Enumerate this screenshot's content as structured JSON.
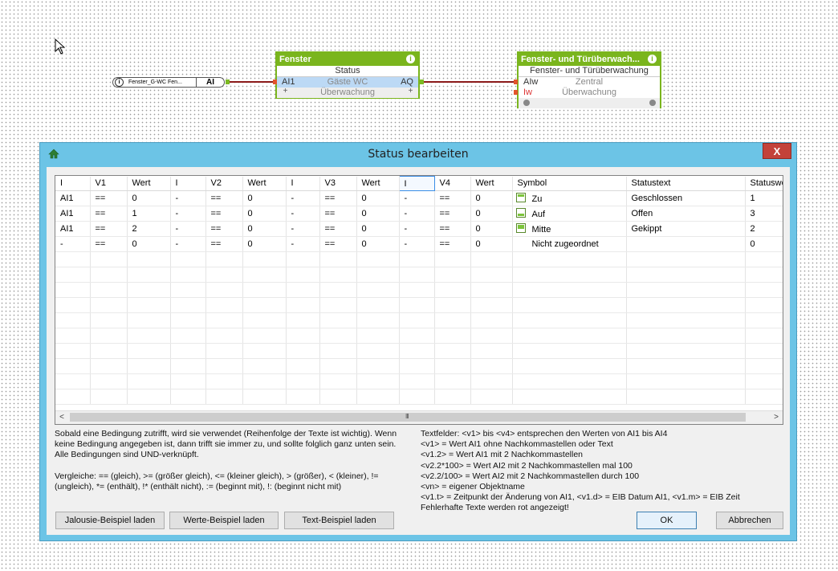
{
  "canvas": {
    "input_node": {
      "info": "i",
      "name": "Fenster_G-WC  Fen...",
      "port": "AI"
    },
    "block1": {
      "title": "Fenster",
      "info": "i",
      "subtitle": "Status",
      "row_left": "AI1",
      "row_center": "Gäste WC",
      "row_right": "AQ",
      "footer_left": "+",
      "footer_center": "Überwachung",
      "footer_right": "+"
    },
    "block2": {
      "title": "Fenster- und Türüberwach...",
      "info": "i",
      "subtitle": "Fenster- und Türüberwachung",
      "row1_left": "AIw",
      "row1_center": "Zentral",
      "row2_left": "Iw",
      "row2_center": "Überwachung"
    }
  },
  "dialog": {
    "title": "Status bearbeiten",
    "close": "X",
    "columns": [
      "I",
      "V1",
      "Wert",
      "I",
      "V2",
      "Wert",
      "I",
      "V3",
      "Wert",
      "I",
      "V4",
      "Wert",
      "Symbol",
      "Statustext",
      "Statuswe"
    ],
    "rows": [
      {
        "c": [
          "AI1",
          "==",
          "0",
          "-",
          "==",
          "0",
          "-",
          "==",
          "0",
          "-",
          "==",
          "0"
        ],
        "sym": "down",
        "symbol": "Zu",
        "text": "Geschlossen",
        "value": "1"
      },
      {
        "c": [
          "AI1",
          "==",
          "1",
          "-",
          "==",
          "0",
          "-",
          "==",
          "0",
          "-",
          "==",
          "0"
        ],
        "sym": "up",
        "symbol": "Auf",
        "text": "Offen",
        "value": "3"
      },
      {
        "c": [
          "AI1",
          "==",
          "2",
          "-",
          "==",
          "0",
          "-",
          "==",
          "0",
          "-",
          "==",
          "0"
        ],
        "sym": "mid",
        "symbol": "Mitte",
        "text": "Gekippt",
        "value": "2"
      },
      {
        "c": [
          "-",
          "==",
          "0",
          "-",
          "==",
          "0",
          "-",
          "==",
          "0",
          "-",
          "==",
          "0"
        ],
        "sym": "",
        "symbol": "Nicht zugeordnet",
        "text": "",
        "value": "0"
      }
    ],
    "scroll_left": "<",
    "scroll_right": ">",
    "scroll_grip": "III",
    "help_left": [
      "Sobald eine Bedingung zutrifft, wird sie verwendet (Reihenfolge der Texte ist wichtig). Wenn",
      "keine Bedingung angegeben ist, dann trifft sie immer zu, und sollte folglich ganz unten sein.",
      "Alle Bedingungen sind UND-verknüpft.",
      "",
      "Vergleiche: == (gleich), >= (größer gleich), <= (kleiner gleich), > (größer), < (kleiner), !=",
      "(ungleich), *= (enthält), !* (enthält nicht), := (beginnt mit), !: (beginnt nicht mit)"
    ],
    "help_right": [
      "Textfelder: <v1> bis <v4> entsprechen den Werten von AI1 bis AI4",
      "<v1> = Wert AI1 ohne Nachkommastellen oder Text",
      "<v1.2> = Wert AI1 mit 2 Nachkommastellen",
      "<v2.2*100> = Wert AI2 mit 2 Nachkommastellen mal 100",
      "<v2.2/100> = Wert AI2 mit 2 Nachkommastellen durch 100",
      "<vn> = eigener Objektname",
      "<v1.t> = Zeitpunkt der Änderung von AI1, <v1.d> = EIB Datum AI1, <v1.m> = EIB Zeit",
      "Fehlerhafte Texte werden rot angezeigt!"
    ],
    "buttons": {
      "jalousie": "Jalousie-Beispiel laden",
      "werte": "Werte-Beispiel laden",
      "text": "Text-Beispiel laden",
      "ok": "OK",
      "cancel": "Abbrechen"
    }
  }
}
